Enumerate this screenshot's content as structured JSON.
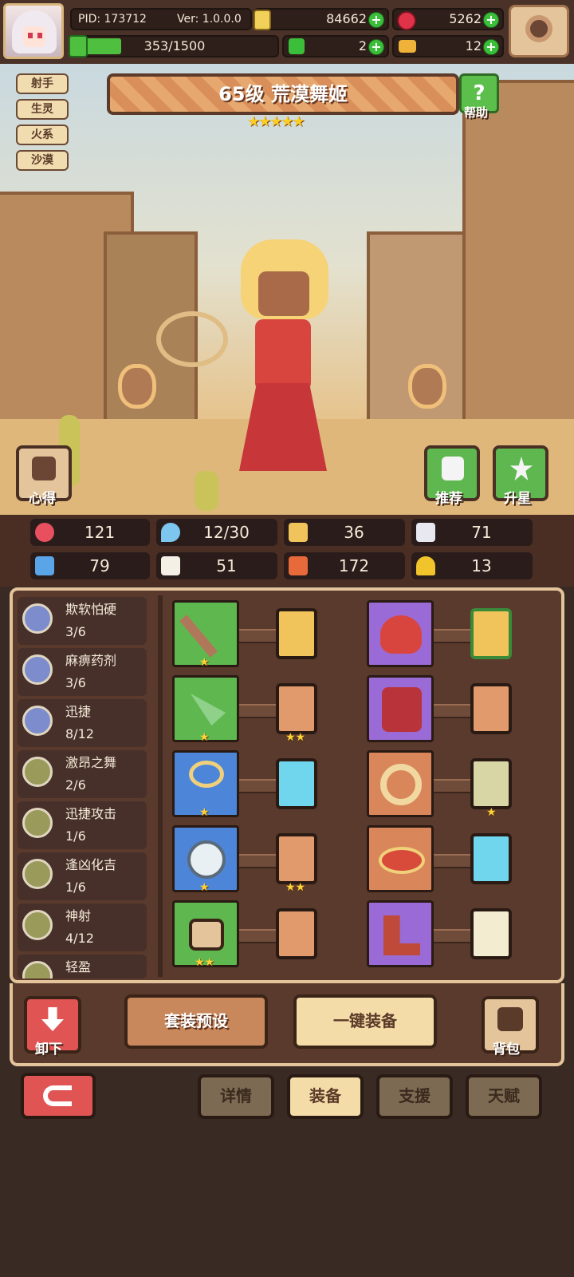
{
  "header": {
    "pid": "PID: 173712",
    "version": "Ver: 1.0.0.0",
    "gold": "84662",
    "gems": "5262",
    "stamina": "353/1500",
    "clover": "2",
    "key": "12"
  },
  "tags": [
    "射手",
    "生灵",
    "火系",
    "沙漠"
  ],
  "character": {
    "title": "65级 荒漠舞姬",
    "stars": "★★★★★",
    "star_count": 5
  },
  "buttons": {
    "help": "帮助",
    "notes": "心得",
    "recommend": "推荐",
    "star_up": "升星",
    "unequip": "卸下",
    "set_preset": "套装预设",
    "auto_equip": "一键装备",
    "backpack": "背包"
  },
  "stats": [
    {
      "icon": "heart-icon",
      "value": "121"
    },
    {
      "icon": "droplet-icon",
      "value": "12/30"
    },
    {
      "icon": "shield-icon",
      "value": "36"
    },
    {
      "icon": "wing-icon",
      "value": "71"
    },
    {
      "icon": "fist-icon",
      "value": "79"
    },
    {
      "icon": "book-icon",
      "value": "51"
    },
    {
      "icon": "potion-icon",
      "value": "172"
    },
    {
      "icon": "horseshoe-icon",
      "value": "13"
    }
  ],
  "skills": [
    {
      "name": "欺软怕硬",
      "level": "3/6"
    },
    {
      "name": "麻痹药剂",
      "level": "3/6"
    },
    {
      "name": "迅捷",
      "level": "8/12"
    },
    {
      "name": "激昂之舞",
      "level": "2/6"
    },
    {
      "name": "迅捷攻击",
      "level": "1/6"
    },
    {
      "name": "逢凶化吉",
      "level": "1/6"
    },
    {
      "name": "神射",
      "level": "4/12"
    },
    {
      "name": "轻盈",
      "level": ""
    }
  ],
  "tabs": [
    "详情",
    "装备",
    "支援",
    "天赋"
  ],
  "active_tab": "装备",
  "colors": {
    "accent_green": "#5fb84f",
    "accent_blue": "#4d86d9",
    "accent_purple": "#9a6bd6",
    "accent_orange": "#d9875a",
    "gold_frame": "#e4c49a",
    "red_button": "#e05454"
  }
}
